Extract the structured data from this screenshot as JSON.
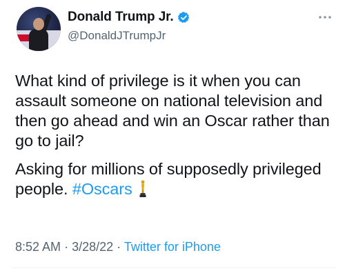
{
  "author": {
    "display_name": "Donald Trump Jr.",
    "handle": "@DonaldJTrumpJr",
    "verified": true
  },
  "tweet": {
    "paragraph1": "What kind of privilege is it when you can assault someone on national television and then go ahead and win an Oscar rather than go to jail?",
    "paragraph2_text": "Asking for millions of supposedly privileged people.",
    "hashtag": "#Oscars",
    "emoji": "oscar-statue-icon"
  },
  "meta": {
    "time": "8:52 AM",
    "date": "3/28/22",
    "source": "Twitter for iPhone",
    "separator": "·"
  },
  "colors": {
    "link": "#1d9bf0",
    "secondary_text": "#536471",
    "primary_text": "#0f1419"
  }
}
